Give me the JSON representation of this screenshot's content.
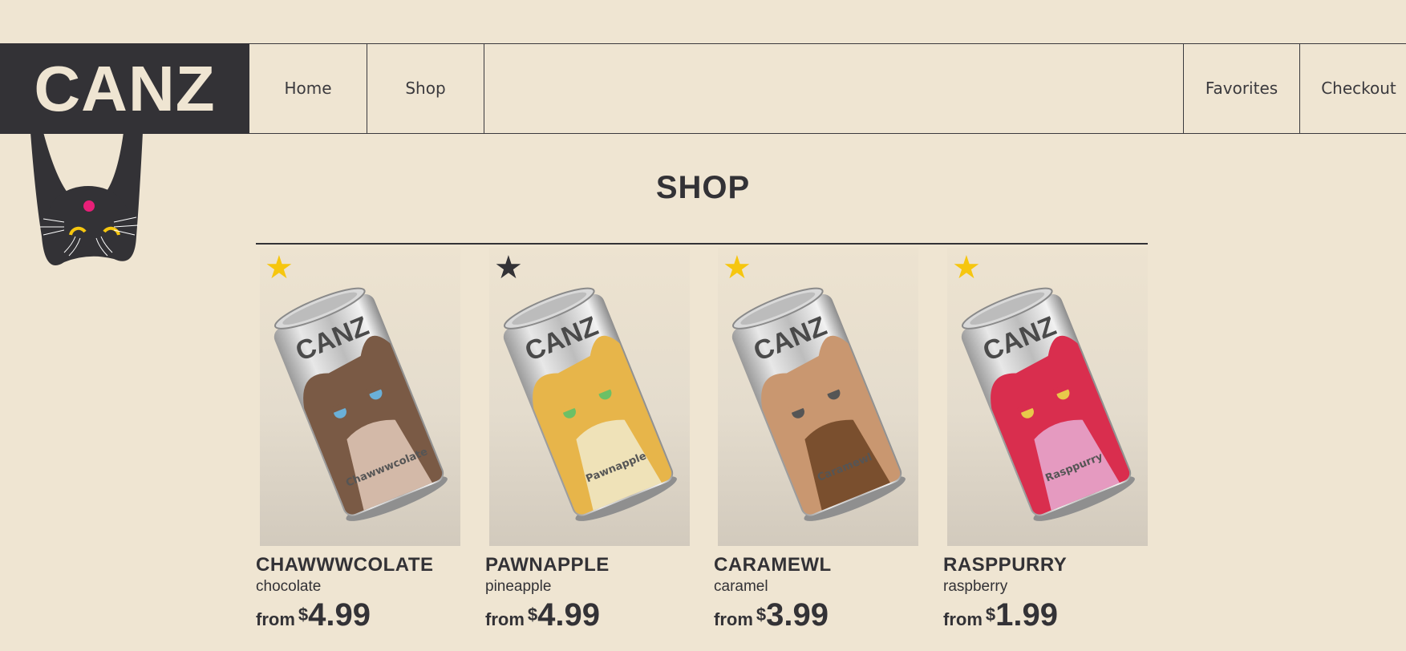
{
  "header": {
    "logo": "CANZ",
    "nav": {
      "home": "Home",
      "shop": "Shop",
      "favorites": "Favorites",
      "checkout": "Checkout"
    }
  },
  "page": {
    "title": "SHOP"
  },
  "products": [
    {
      "name": "CHAWWWCOLATE",
      "flavor": "chocolate",
      "from": "from",
      "currency": "$",
      "price": "4.99",
      "can_label": "Chawwwcolate",
      "favorite": true,
      "cat_color": "#7a5a45",
      "body_color": "#d3b9a8",
      "eye_color": "#6ab0d8"
    },
    {
      "name": "PAWNAPPLE",
      "flavor": "pineapple",
      "from": "from",
      "currency": "$",
      "price": "4.99",
      "can_label": "Pawnapple",
      "favorite": false,
      "cat_color": "#e7b54a",
      "body_color": "#efe2b8",
      "eye_color": "#6cc066"
    },
    {
      "name": "CARAMEWL",
      "flavor": "caramel",
      "from": "from",
      "currency": "$",
      "price": "3.99",
      "can_label": "Caramewl",
      "favorite": true,
      "cat_color": "#c99770",
      "body_color": "#7a4f2e",
      "eye_color": "#555555"
    },
    {
      "name": "RASPPURRY",
      "flavor": "raspberry",
      "from": "from",
      "currency": "$",
      "price": "1.99",
      "can_label": "Rasppurry",
      "favorite": true,
      "cat_color": "#d92e4e",
      "body_color": "#e59ac0",
      "eye_color": "#e8c94a"
    }
  ],
  "icons": {
    "star": "star-icon",
    "mascot": "cat-mascot-icon"
  },
  "colors": {
    "background": "#efe5d2",
    "dark": "#333236",
    "star_active": "#f6c60f"
  }
}
